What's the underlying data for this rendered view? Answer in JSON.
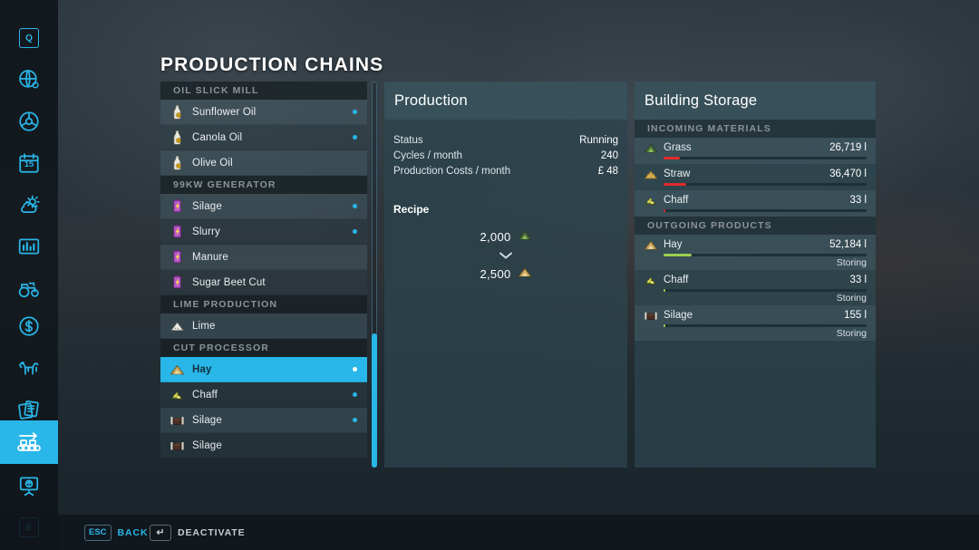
{
  "page": {
    "title": "PRODUCTION CHAINS"
  },
  "rail": {
    "items": [
      {
        "name": "quickmenu-key",
        "icon": "key-q",
        "label": "Q",
        "active": false
      },
      {
        "name": "map-overview",
        "icon": "globe-icon",
        "label": "",
        "active": false
      },
      {
        "name": "vehicles",
        "icon": "steering-wheel-icon",
        "label": "",
        "active": false
      },
      {
        "name": "calendar",
        "icon": "calendar-icon",
        "label": "15",
        "active": false
      },
      {
        "name": "weather",
        "icon": "weather-icon",
        "label": "",
        "active": false
      },
      {
        "name": "statistics",
        "icon": "chart-icon",
        "label": "",
        "active": false
      },
      {
        "name": "machinery",
        "icon": "tractor-icon",
        "label": "",
        "active": false
      },
      {
        "name": "finances",
        "icon": "dollar-icon",
        "label": "",
        "active": false
      },
      {
        "name": "animals",
        "icon": "cow-icon",
        "label": "",
        "active": false
      },
      {
        "name": "contracts",
        "icon": "documents-icon",
        "label": "",
        "active": false
      },
      {
        "name": "production-chains",
        "icon": "conveyor-icon",
        "label": "",
        "active": true
      },
      {
        "name": "info-board",
        "icon": "presentation-icon",
        "label": "",
        "active": false
      },
      {
        "name": "exit-key",
        "icon": "key-e",
        "label": "E",
        "active": false
      }
    ]
  },
  "production_list": [
    {
      "type": "group",
      "label": "OIL SLICK MILL"
    },
    {
      "type": "item",
      "label": "Sunflower Oil",
      "icon": "oil-bottle-icon",
      "dot": true,
      "selected": false
    },
    {
      "type": "item",
      "label": "Canola Oil",
      "icon": "oil-bottle-icon",
      "dot": true,
      "selected": false
    },
    {
      "type": "item",
      "label": "Olive Oil",
      "icon": "oil-bottle-icon",
      "dot": false,
      "selected": false
    },
    {
      "type": "group",
      "label": "99KW GENERATOR"
    },
    {
      "type": "item",
      "label": "Silage",
      "icon": "battery-icon",
      "dot": true,
      "selected": false
    },
    {
      "type": "item",
      "label": "Slurry",
      "icon": "battery-icon",
      "dot": true,
      "selected": false
    },
    {
      "type": "item",
      "label": "Manure",
      "icon": "battery-icon",
      "dot": false,
      "selected": false
    },
    {
      "type": "item",
      "label": "Sugar Beet Cut",
      "icon": "battery-icon",
      "dot": false,
      "selected": false
    },
    {
      "type": "group",
      "label": "LIME PRODUCTION"
    },
    {
      "type": "item",
      "label": "Lime",
      "icon": "lime-pile-icon",
      "dot": false,
      "selected": false
    },
    {
      "type": "group",
      "label": "CUT PROCESSOR"
    },
    {
      "type": "item",
      "label": "Hay",
      "icon": "hay-pile-icon",
      "dot": true,
      "selected": true
    },
    {
      "type": "item",
      "label": "Chaff",
      "icon": "chaff-icon",
      "dot": true,
      "selected": false
    },
    {
      "type": "item",
      "label": "Silage",
      "icon": "silage-bale-icon",
      "dot": true,
      "selected": false
    },
    {
      "type": "item",
      "label": "Silage",
      "icon": "silage-bale-icon",
      "dot": false,
      "selected": false
    }
  ],
  "production": {
    "title": "Production",
    "stats": [
      {
        "label": "Status",
        "value": "Running"
      },
      {
        "label": "Cycles / month",
        "value": "240"
      },
      {
        "label": "Production Costs / month",
        "value": "£ 48"
      }
    ],
    "recipe_label": "Recipe",
    "recipe": {
      "input": {
        "amount": "2,000",
        "icon": "grass-icon"
      },
      "arrow": "chevron-down-icon",
      "output": {
        "amount": "2,500",
        "icon": "hay-icon"
      }
    }
  },
  "building_storage": {
    "title": "Building Storage",
    "sections": [
      {
        "header": "INCOMING MATERIALS",
        "bar_color": "#e02b2b",
        "rows": [
          {
            "name": "Grass",
            "icon": "grass-icon",
            "amount": "26,719 l",
            "fill": 8,
            "state": ""
          },
          {
            "name": "Straw",
            "icon": "straw-icon",
            "amount": "36,470 l",
            "fill": 11,
            "state": ""
          },
          {
            "name": "Chaff",
            "icon": "chaff-icon",
            "amount": "33 l",
            "fill": 1,
            "state": ""
          }
        ]
      },
      {
        "header": "OUTGOING PRODUCTS",
        "bar_color": "#9bd14f",
        "rows": [
          {
            "name": "Hay",
            "icon": "hay-icon",
            "amount": "52,184 l",
            "fill": 14,
            "state": "Storing"
          },
          {
            "name": "Chaff",
            "icon": "chaff-icon",
            "amount": "33 l",
            "fill": 1,
            "state": "Storing"
          },
          {
            "name": "Silage",
            "icon": "silage-bale-icon",
            "amount": "155 l",
            "fill": 1,
            "state": "Storing"
          }
        ]
      }
    ]
  },
  "footer": {
    "hints": [
      {
        "key": "ESC",
        "icon": "esc-key",
        "label": "BACK",
        "accent": "cyan"
      },
      {
        "key": "↵",
        "icon": "enter-key",
        "label": "DEACTIVATE",
        "accent": "gray"
      }
    ]
  },
  "colors": {
    "accent": "#29b6e8",
    "bar_low": "#e02b2b",
    "bar_ok": "#9bd14f",
    "panel": "#2c434c"
  }
}
